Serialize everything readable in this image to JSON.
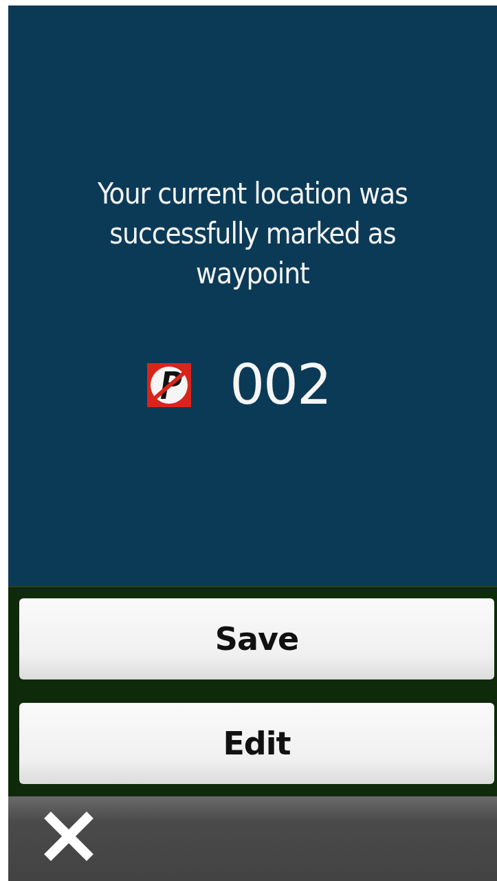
{
  "message": "Your current location was successfully marked as waypoint",
  "waypoint": {
    "name": "002"
  },
  "buttons": [
    {
      "label": "Save"
    },
    {
      "label": "Edit"
    }
  ]
}
